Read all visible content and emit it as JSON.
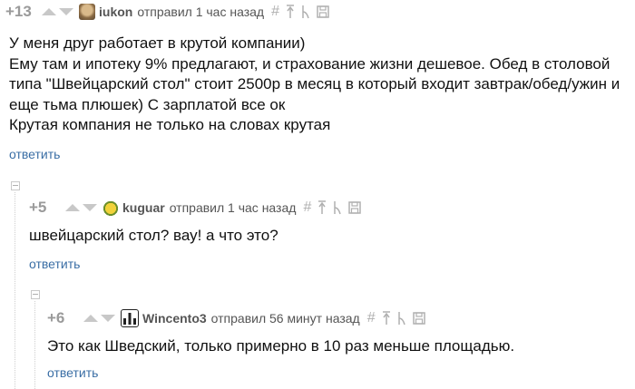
{
  "comments": [
    {
      "score": "+13",
      "username": "iukon",
      "meta": "отправил 1 час назад",
      "lines": [
        "У меня друг работает в крутой компании)",
        "Ему там и ипотеку 9% предлагают, и страхование жизни дешевое. Обед в столовой",
        "типа \"Швейцарский стол\" стоит 2500р в месяц в который входит завтрак/обед/ужин и",
        "еще тьма плюшек) С зарплатой все ок",
        "Крутая компания не только на словах крутая"
      ],
      "reply": "ответить"
    },
    {
      "score": "+5",
      "username": "kuguar",
      "meta": "отправил 1 час назад",
      "lines": [
        "швейцарский стол? вау! а что это?"
      ],
      "reply": "ответить"
    },
    {
      "score": "+6",
      "username": "Wincento3",
      "meta": "отправил 56 минут назад",
      "lines": [
        "Это как Шведский, только примерно в 10 раз меньше площадью."
      ],
      "reply": "ответить"
    }
  ],
  "icons": [
    "hash-icon",
    "parent-comment-icon",
    "thread-icon",
    "save-icon"
  ],
  "colors": {
    "link": "#3a6ea5",
    "score": "#9a9a9a",
    "muted": "#b0b0b0"
  }
}
